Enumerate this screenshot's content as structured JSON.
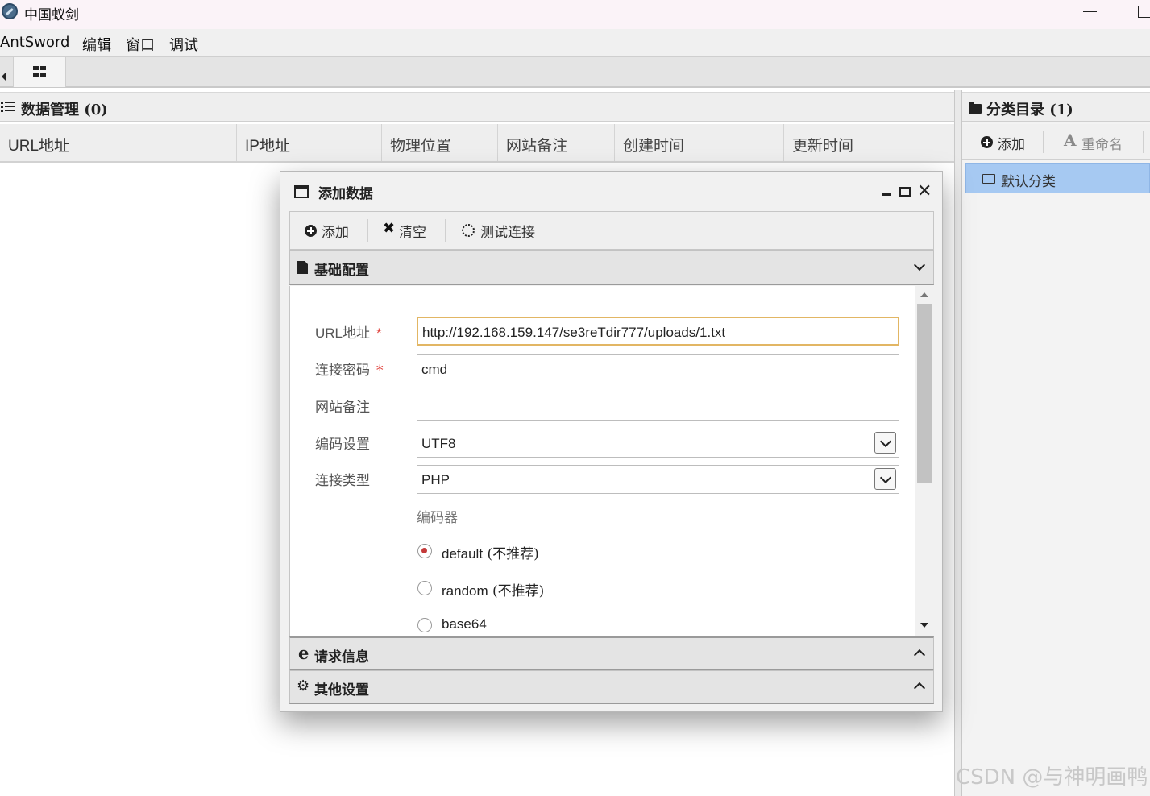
{
  "window": {
    "title": "中国蚁剑",
    "icon": "antsword-logo-icon"
  },
  "menubar": {
    "items": [
      "AntSword",
      "编辑",
      "窗口",
      "调试"
    ]
  },
  "tabs": {
    "home_icon": "grid-icon"
  },
  "data_panel": {
    "title": "数据管理 (0)",
    "columns": [
      "URL地址",
      "IP地址",
      "物理位置",
      "网站备注",
      "创建时间",
      "更新时间"
    ]
  },
  "category_panel": {
    "title": "分类目录 (1)",
    "add_label": "添加",
    "rename_label": "重命名",
    "items": [
      "默认分类"
    ]
  },
  "dialog": {
    "title": "添加数据",
    "toolbar": {
      "add": "添加",
      "clear": "清空",
      "test": "测试连接"
    },
    "sections": {
      "basic": "基础配置",
      "request": "请求信息",
      "other": "其他设置"
    },
    "form": {
      "url_label": "URL地址",
      "url_value": "http://192.168.159.147/se3reTdir777/uploads/1.txt",
      "password_label": "连接密码",
      "password_value": "cmd",
      "note_label": "网站备注",
      "note_value": "",
      "encoding_label": "编码设置",
      "encoding_value": "UTF8",
      "type_label": "连接类型",
      "type_value": "PHP",
      "required_mark": "*",
      "encoder_label": "编码器",
      "encoders": [
        {
          "name": "default",
          "note": " (不推荐)",
          "selected": true
        },
        {
          "name": "random",
          "note": " (不推荐)",
          "selected": false
        },
        {
          "name": "base64",
          "note": "",
          "selected": false
        }
      ]
    }
  },
  "watermark": "CSDN @与神明画鸭",
  "colors": {
    "selected_category": "#a6c9f2",
    "focus_border": "#e2b664",
    "required": "#e0423c",
    "radio_selected": "#c43b3b"
  }
}
